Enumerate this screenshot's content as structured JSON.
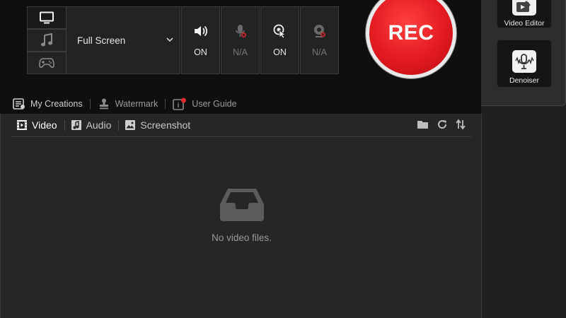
{
  "capture": {
    "mode_options": [
      "screen",
      "audio",
      "game"
    ],
    "active_mode": "screen",
    "screen_area": "Full Screen"
  },
  "toggles": {
    "speaker": {
      "label": "ON",
      "icon": "speaker-icon"
    },
    "microphone": {
      "label": "N/A",
      "icon": "microphone-off-icon"
    },
    "mouse": {
      "label": "ON",
      "icon": "mouse-click-icon"
    },
    "webcam": {
      "label": "N/A",
      "icon": "webcam-off-icon"
    }
  },
  "rec_button": {
    "label": "REC",
    "color": "#e21a20"
  },
  "bottom_links": {
    "my_creations": "My Creations",
    "watermark": "Watermark",
    "user_guide": "User Guide"
  },
  "tools": {
    "video_editor": "Video Editor",
    "denoiser": "Denoiser"
  },
  "files": {
    "tabs": [
      {
        "label": "Video",
        "icon": "film-icon",
        "active": true
      },
      {
        "label": "Audio",
        "icon": "music-note-icon",
        "active": false
      },
      {
        "label": "Screenshot",
        "icon": "image-icon",
        "active": false
      }
    ],
    "empty_message": "No video files."
  }
}
